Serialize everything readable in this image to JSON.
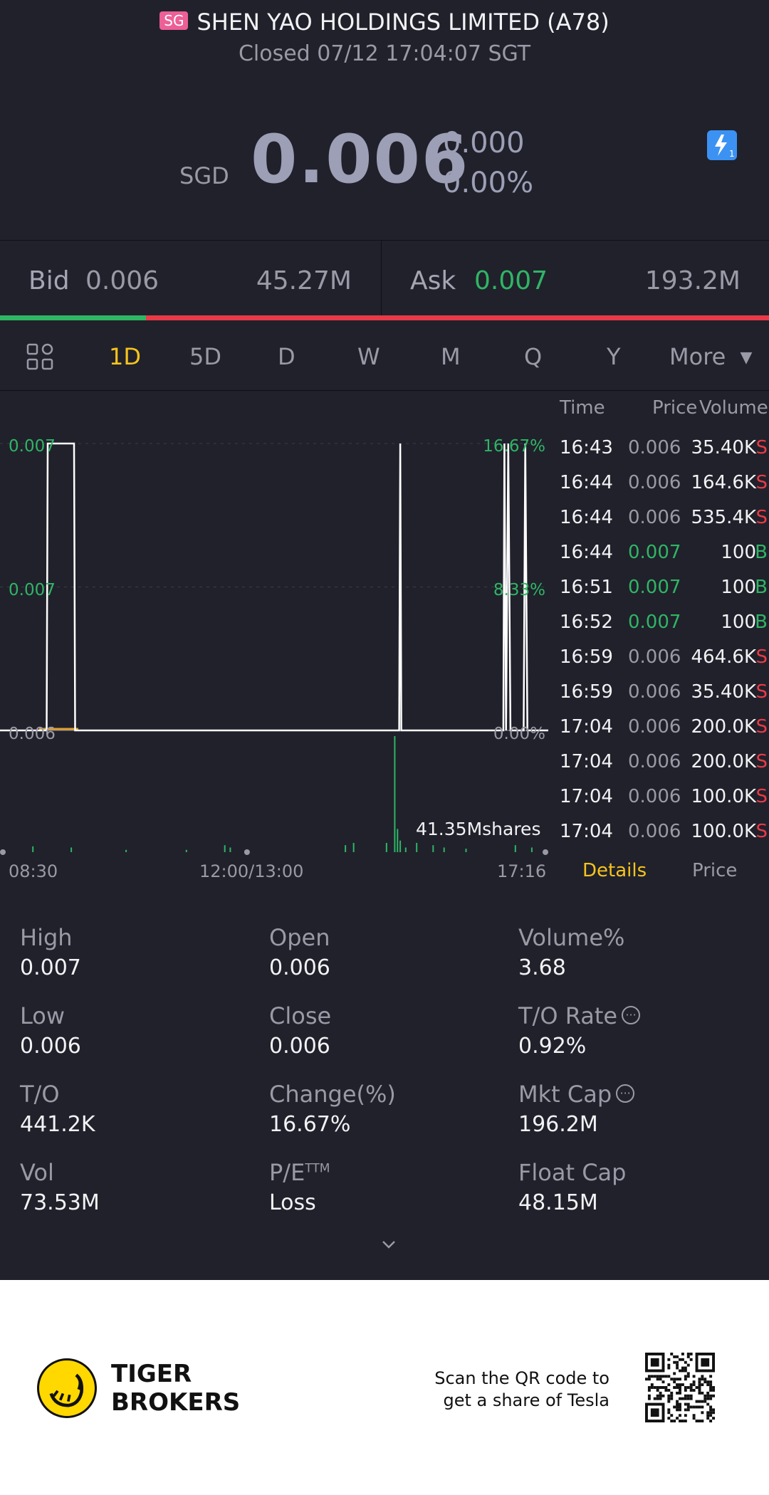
{
  "header": {
    "market_badge": "SG",
    "title": "SHEN YAO HOLDINGS LIMITED (A78)",
    "status": "Closed 07/12 17:04:07 SGT"
  },
  "quote": {
    "currency": "SGD",
    "price": "0.006",
    "change": "0.000",
    "change_pct": "0.00%",
    "flash_icon_badge": "1"
  },
  "bid_ask": {
    "bid_label": "Bid",
    "bid_price": "0.006",
    "bid_size": "45.27M",
    "ask_label": "Ask",
    "ask_price": "0.007",
    "ask_size": "193.2M",
    "bid_ratio": 0.19
  },
  "period_tabs": {
    "items": [
      "1D",
      "5D",
      "D",
      "W",
      "M",
      "Q",
      "Y"
    ],
    "active": "1D",
    "more_label": "More"
  },
  "ticks": {
    "headers": {
      "time": "Time",
      "price": "Price",
      "volume": "Volume"
    },
    "rows": [
      {
        "time": "16:43",
        "price": "0.006",
        "volume": "35.40K",
        "side": "S"
      },
      {
        "time": "16:44",
        "price": "0.006",
        "volume": "164.6K",
        "side": "S"
      },
      {
        "time": "16:44",
        "price": "0.006",
        "volume": "535.4K",
        "side": "S"
      },
      {
        "time": "16:44",
        "price": "0.007",
        "volume": "100",
        "side": "B"
      },
      {
        "time": "16:51",
        "price": "0.007",
        "volume": "100",
        "side": "B"
      },
      {
        "time": "16:52",
        "price": "0.007",
        "volume": "100",
        "side": "B"
      },
      {
        "time": "16:59",
        "price": "0.006",
        "volume": "464.6K",
        "side": "S"
      },
      {
        "time": "16:59",
        "price": "0.006",
        "volume": "35.40K",
        "side": "S"
      },
      {
        "time": "17:04",
        "price": "0.006",
        "volume": "200.0K",
        "side": "S"
      },
      {
        "time": "17:04",
        "price": "0.006",
        "volume": "200.0K",
        "side": "S"
      },
      {
        "time": "17:04",
        "price": "0.006",
        "volume": "100.0K",
        "side": "S"
      },
      {
        "time": "17:04",
        "price": "0.006",
        "volume": "100.0K",
        "side": "S"
      }
    ],
    "tab_details": "Details",
    "tab_price": "Price"
  },
  "chart_data": {
    "type": "line",
    "y_labels_left": [
      "0.007",
      "0.007",
      "0.006"
    ],
    "y_labels_right": [
      "16.67%",
      "8.33%",
      "0.00%"
    ],
    "x_labels": [
      "08:30",
      "12:00/13:00",
      "17:16"
    ],
    "ylim": [
      0.006,
      0.007
    ],
    "price_points": [
      [
        0.0,
        0.006
      ],
      [
        0.085,
        0.006
      ],
      [
        0.087,
        0.007
      ],
      [
        0.135,
        0.007
      ],
      [
        0.137,
        0.006
      ],
      [
        0.728,
        0.006
      ],
      [
        0.73,
        0.007
      ],
      [
        0.732,
        0.006
      ],
      [
        0.918,
        0.006
      ],
      [
        0.92,
        0.007
      ],
      [
        0.923,
        0.006
      ],
      [
        0.927,
        0.007
      ],
      [
        0.931,
        0.006
      ],
      [
        0.955,
        0.006
      ],
      [
        0.958,
        0.007
      ],
      [
        0.962,
        0.006
      ],
      [
        1.0,
        0.006
      ]
    ],
    "volume_label": "41.35Mshares",
    "volume_bars": [
      [
        0.06,
        0.05
      ],
      [
        0.13,
        0.04
      ],
      [
        0.23,
        0.02
      ],
      [
        0.34,
        0.02
      ],
      [
        0.41,
        0.06
      ],
      [
        0.42,
        0.04
      ],
      [
        0.63,
        0.06
      ],
      [
        0.645,
        0.08
      ],
      [
        0.705,
        0.08
      ],
      [
        0.72,
        1.0
      ],
      [
        0.725,
        0.2
      ],
      [
        0.73,
        0.1
      ],
      [
        0.74,
        0.04
      ],
      [
        0.76,
        0.08
      ],
      [
        0.79,
        0.06
      ],
      [
        0.81,
        0.04
      ],
      [
        0.85,
        0.03
      ],
      [
        0.94,
        0.06
      ],
      [
        0.97,
        0.04
      ]
    ],
    "colors": {
      "price": "#ffffff",
      "avg": "#e0a030",
      "volume": "#2fb565"
    }
  },
  "stats": {
    "high_label": "High",
    "high": "0.007",
    "open_label": "Open",
    "open": "0.006",
    "volume_pct_label": "Volume%",
    "volume_pct": "3.68",
    "low_label": "Low",
    "low": "0.006",
    "close_label": "Close",
    "close": "0.006",
    "to_rate_label": "T/O Rate",
    "to_rate": "0.92%",
    "turnover_label": "T/O",
    "turnover": "441.2K",
    "change_label": "Change(%)",
    "change": "16.67%",
    "mkt_cap_label": "Mkt Cap",
    "mkt_cap": "196.2M",
    "vol_label": "Vol",
    "vol": "73.53M",
    "pe_label": "P/E",
    "pe_sup": "TTM",
    "pe": "Loss",
    "float_cap_label": "Float Cap",
    "float_cap": "48.15M"
  },
  "footer": {
    "brand_line1": "TIGER",
    "brand_line2": "BROKERS",
    "promo_line1": "Scan the QR code to",
    "promo_line2": "get a share of Tesla"
  },
  "colors": {
    "background": "#20212b",
    "green": "#2fb565",
    "red": "#e83a47",
    "accent": "#f7c41d",
    "muted": "#9a9aa6"
  }
}
